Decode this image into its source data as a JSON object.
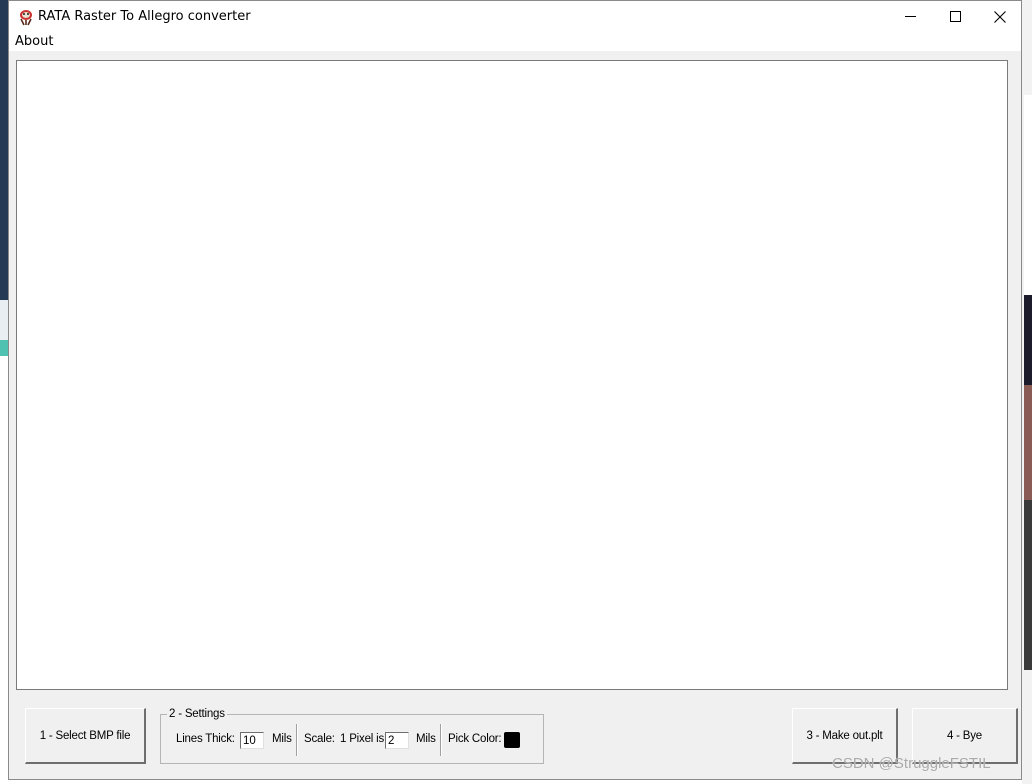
{
  "window": {
    "title": "RATA Raster To Allegro converter",
    "controls": {
      "minimize": "─",
      "maximize": "☐",
      "close": "✕"
    }
  },
  "menu": {
    "about": "About"
  },
  "buttons": {
    "select_bmp": "1 - Select BMP file",
    "make_out": "3 - Make out.plt",
    "bye": "4 - Bye"
  },
  "settings": {
    "legend": "2 - Settings",
    "lines_thick_label": "Lines Thick:",
    "lines_thick_value": "10",
    "lines_thick_unit": "Mils",
    "scale_label": "Scale:",
    "pixel_label": "1 Pixel is",
    "pixel_value": "2",
    "pixel_unit": "Mils",
    "pick_color_label": "Pick Color:",
    "pick_color_value": "#000000"
  },
  "watermark": "CSDN @StruggleFSTIL",
  "colors": {
    "window_bg": "#f0f0f0",
    "canvas_bg": "#ffffff",
    "titlebar_bg": "#ffffff"
  }
}
